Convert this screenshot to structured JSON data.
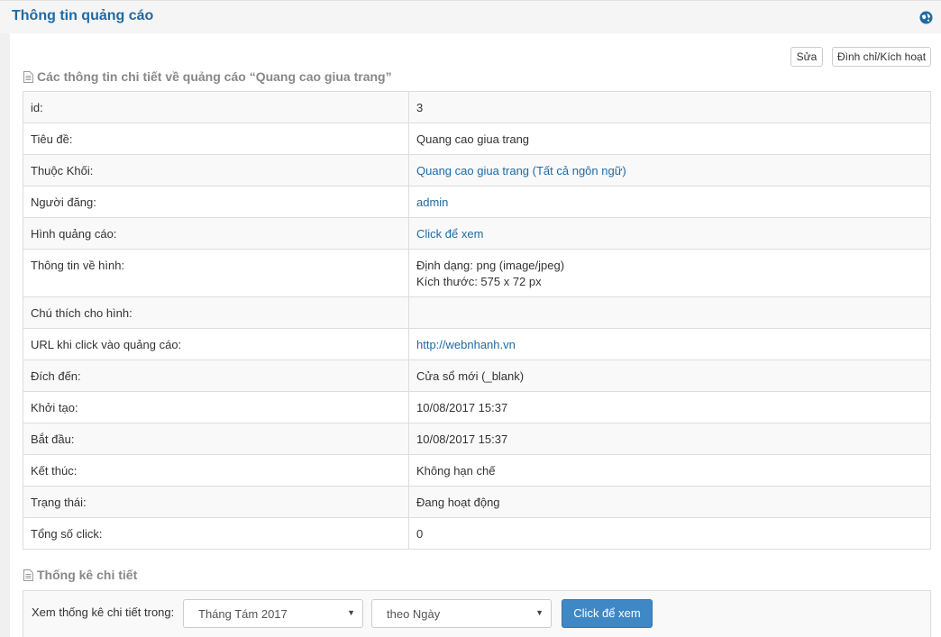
{
  "header": {
    "title": "Thông tin quảng cáo"
  },
  "toolbar": {
    "edit_label": "Sửa",
    "toggle_label": "Đình chỉ/Kích hoạt"
  },
  "details": {
    "section_title": "Các thông tin chi tiết về quảng cáo “Quang cao giua trang”",
    "rows": [
      {
        "label": "id:",
        "value": "3"
      },
      {
        "label": "Tiêu đề:",
        "value": "Quang cao giua trang"
      },
      {
        "label": "Thuộc Khối:",
        "value": "Quang cao giua trang (Tất cả ngôn ngữ)"
      },
      {
        "label": "Người đăng:",
        "value": "admin"
      },
      {
        "label": "Hình quảng cáo:",
        "value": "Click để xem"
      },
      {
        "label": "Thông tin về hình:",
        "value": "Định dạng: png (image/jpeg)",
        "value2": "Kích thước: 575 x 72 px"
      },
      {
        "label": "Chú thích cho hình:",
        "value": ""
      },
      {
        "label": "URL khi click vào quảng cáo:",
        "value": "http://webnhanh.vn"
      },
      {
        "label": "Đích đến:",
        "value": "Cửa sổ mới (_blank)"
      },
      {
        "label": "Khởi tạo:",
        "value": "10/08/2017 15:37"
      },
      {
        "label": "Bắt đầu:",
        "value": "10/08/2017 15:37"
      },
      {
        "label": "Kết thúc:",
        "value": "Không hạn chế"
      },
      {
        "label": "Trạng thái:",
        "value": "Đang hoạt động"
      },
      {
        "label": "Tổng số click:",
        "value": "0"
      }
    ]
  },
  "stats": {
    "section_title": "Thống kê chi tiết",
    "label": "Xem thống kê chi tiết trong:",
    "month_selected": "Tháng Tám 2017",
    "by_selected": "theo Ngày",
    "view_button": "Click để xem"
  },
  "colors": {
    "accent": "#1f6aa3",
    "button_primary": "#3f88c6"
  }
}
